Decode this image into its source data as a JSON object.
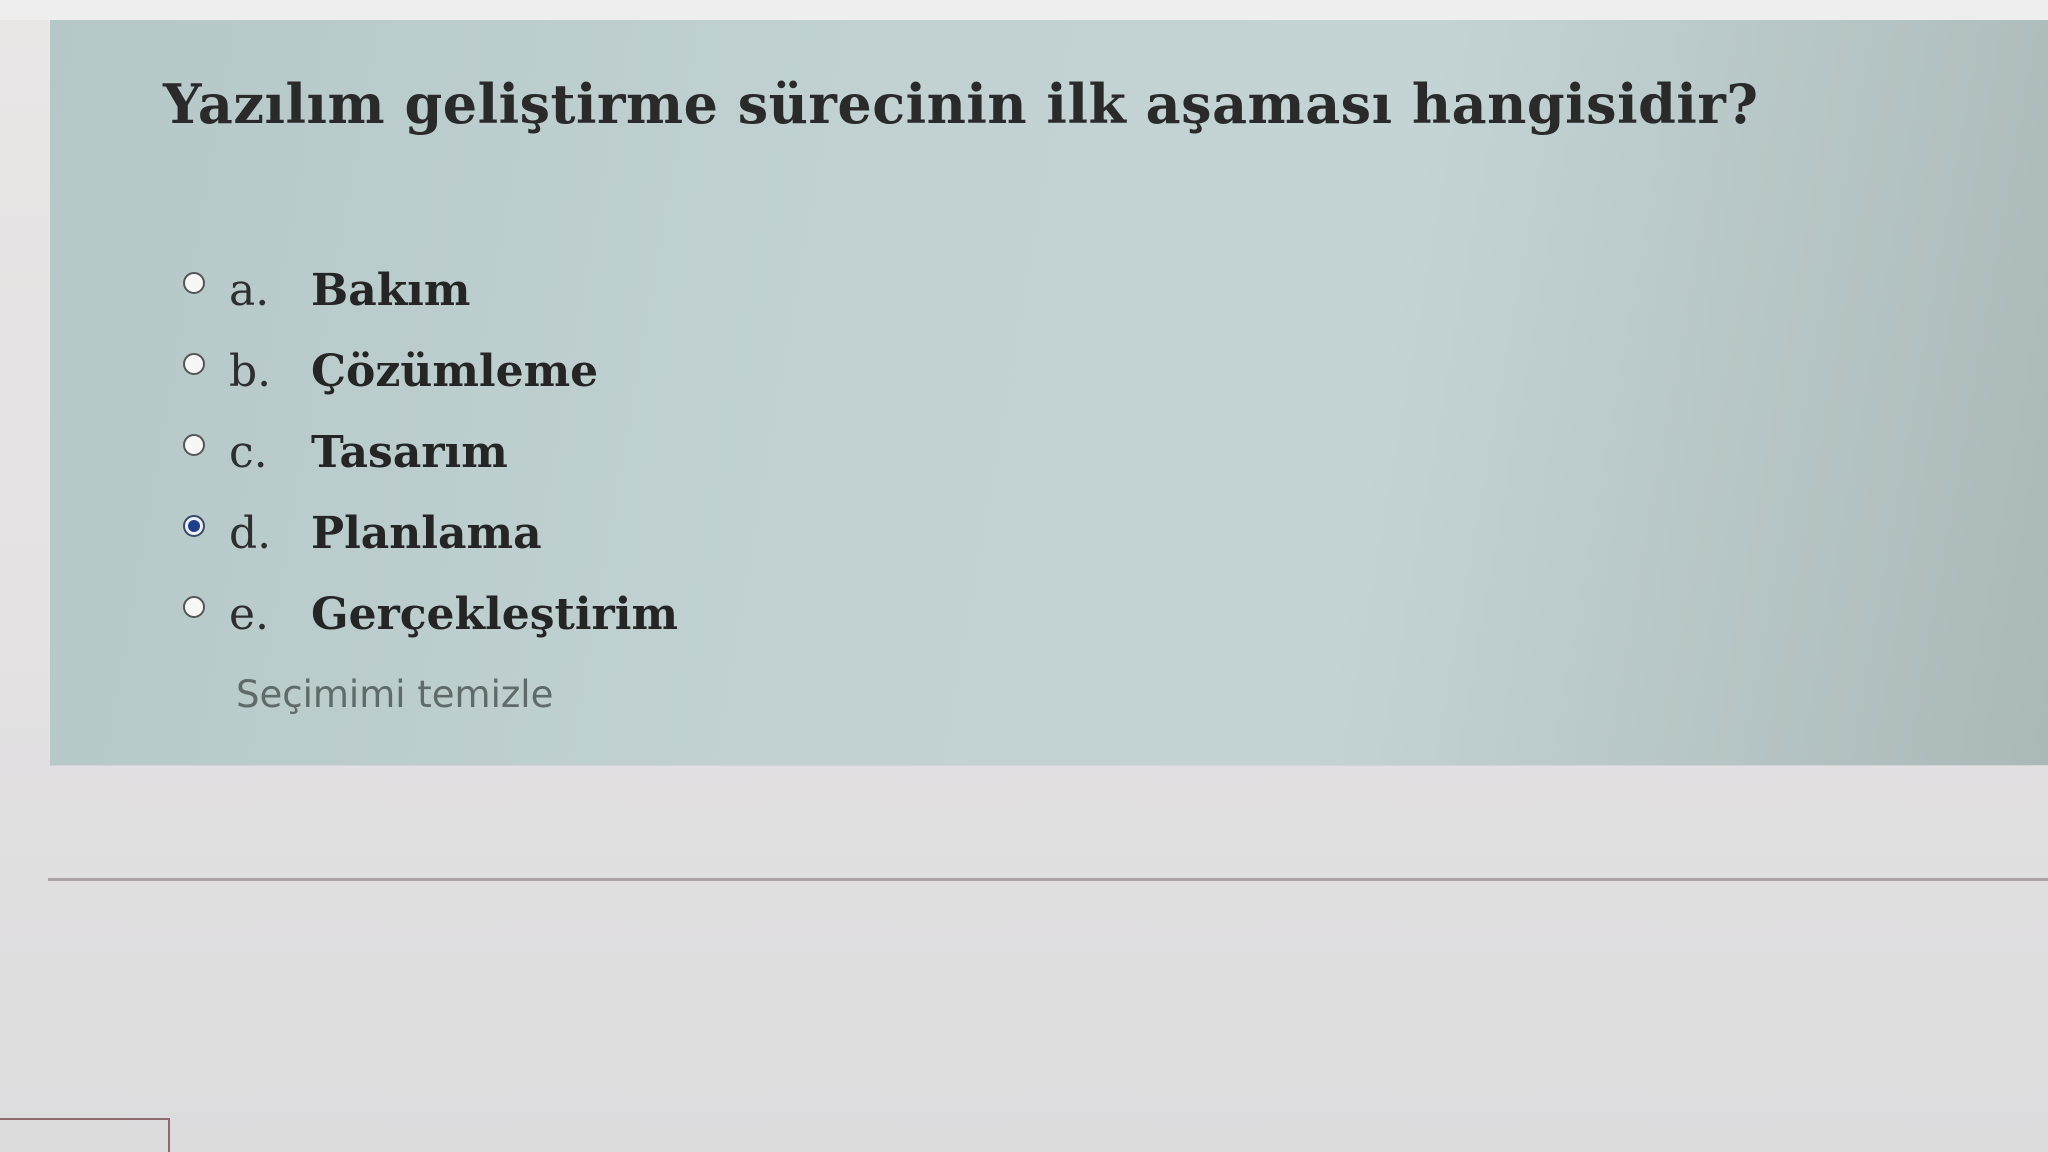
{
  "question": {
    "text": "Yazılım geliştirme sürecinin ilk aşaması hangisidir?"
  },
  "answers": [
    {
      "letter": "a.",
      "text": "Bakım",
      "selected": false
    },
    {
      "letter": "b.",
      "text": "Çözümleme",
      "selected": false
    },
    {
      "letter": "c.",
      "text": "Tasarım",
      "selected": false
    },
    {
      "letter": "d.",
      "text": "Planlama",
      "selected": true
    },
    {
      "letter": "e.",
      "text": "Gerçekleştirim",
      "selected": false
    }
  ],
  "clear_choice_label": "Seçimimi temizle",
  "colors": {
    "panel_bg": "#c2d2d2",
    "selected_radio": "#1f3f88",
    "link_text": "#5f6a6a"
  }
}
